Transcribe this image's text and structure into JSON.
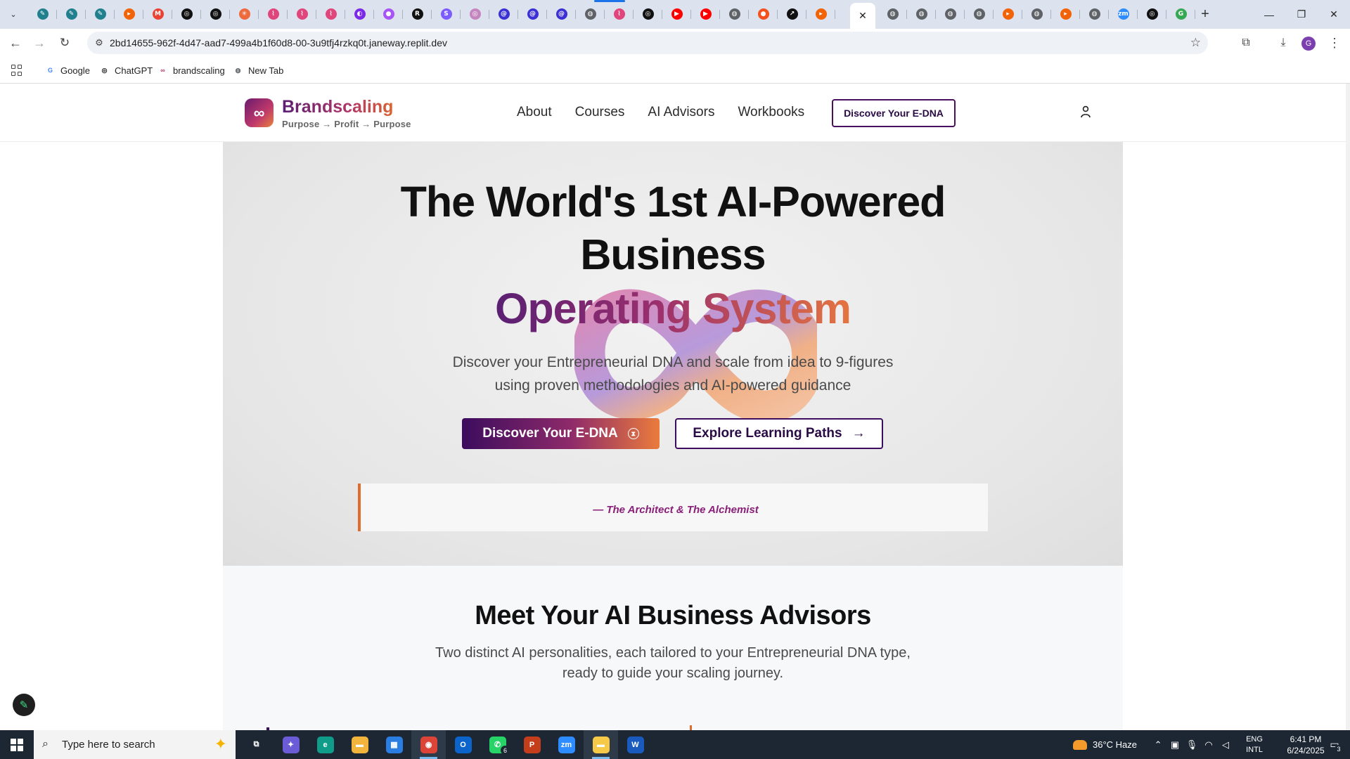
{
  "browser": {
    "url": "2bd14655-962f-4d47-aad7-499a4b1f60d8-00-3u9tfj4rzkq0t.janeway.replit.dev",
    "tab_favicons": [
      {
        "icon": "perplexity-icon",
        "color": "#20808d",
        "glyph": "✎"
      },
      {
        "icon": "perplexity-icon",
        "color": "#20808d",
        "glyph": "✎"
      },
      {
        "icon": "perplexity-icon",
        "color": "#20808d",
        "glyph": "✎"
      },
      {
        "icon": "replit-icon",
        "color": "#f26207",
        "glyph": "▸"
      },
      {
        "icon": "gmail-icon",
        "color": "#ea4335",
        "glyph": "M"
      },
      {
        "icon": "chatgpt-icon",
        "color": "#111111",
        "glyph": "◎"
      },
      {
        "icon": "chatgpt-icon",
        "color": "#111111",
        "glyph": "◎"
      },
      {
        "icon": "claude-icon",
        "color": "#ee6a3c",
        "glyph": "✳"
      },
      {
        "icon": "make-icon",
        "color": "#e0457b",
        "glyph": "⌇"
      },
      {
        "icon": "make-icon",
        "color": "#e0457b",
        "glyph": "⌇"
      },
      {
        "icon": "make-icon",
        "color": "#e0457b",
        "glyph": "⌇"
      },
      {
        "icon": "canva-icon",
        "color": "#7d2ae8",
        "glyph": "◐"
      },
      {
        "icon": "shape-icon",
        "color": "#a855f7",
        "glyph": "●"
      },
      {
        "icon": "r-icon",
        "color": "#111111",
        "glyph": "R"
      },
      {
        "icon": "s-icon",
        "color": "#7c5cff",
        "glyph": "S"
      },
      {
        "icon": "wix-icon",
        "color": "#c586c0",
        "glyph": "◎"
      },
      {
        "icon": "at-icon",
        "color": "#3b2fd6",
        "glyph": "@"
      },
      {
        "icon": "at-icon",
        "color": "#3b2fd6",
        "glyph": "@"
      },
      {
        "icon": "at-icon",
        "color": "#3b2fd6",
        "glyph": "@"
      },
      {
        "icon": "globe-icon",
        "color": "#5f6368",
        "glyph": "◍"
      },
      {
        "icon": "make-icon",
        "color": "#e0457b",
        "glyph": "⌇"
      },
      {
        "icon": "chatgpt-icon",
        "color": "#111111",
        "glyph": "◎"
      },
      {
        "icon": "youtube-icon",
        "color": "#ff0000",
        "glyph": "▶"
      },
      {
        "icon": "youtube-icon",
        "color": "#ff0000",
        "glyph": "▶"
      },
      {
        "icon": "globe-icon",
        "color": "#5f6368",
        "glyph": "◍"
      },
      {
        "icon": "record-icon",
        "color": "#f4511e",
        "glyph": "●"
      },
      {
        "icon": "chart-icon",
        "color": "#111111",
        "glyph": "↗"
      },
      {
        "icon": "replit-icon",
        "color": "#f26207",
        "glyph": "▸"
      }
    ],
    "tab_favicons_right": [
      {
        "icon": "globe-icon",
        "color": "#5f6368",
        "glyph": "◍"
      },
      {
        "icon": "globe-icon",
        "color": "#5f6368",
        "glyph": "◍"
      },
      {
        "icon": "globe-icon",
        "color": "#5f6368",
        "glyph": "◍"
      },
      {
        "icon": "globe-icon",
        "color": "#5f6368",
        "glyph": "◍"
      },
      {
        "icon": "replit-icon",
        "color": "#f26207",
        "glyph": "▸"
      },
      {
        "icon": "globe-icon",
        "color": "#5f6368",
        "glyph": "◍"
      },
      {
        "icon": "replit-icon",
        "color": "#f26207",
        "glyph": "▸"
      },
      {
        "icon": "globe-icon",
        "color": "#5f6368",
        "glyph": "◍"
      },
      {
        "icon": "zoom-icon",
        "color": "#2d8cff",
        "glyph": "zm"
      },
      {
        "icon": "chatgpt-icon",
        "color": "#111111",
        "glyph": "◎"
      },
      {
        "icon": "google-lens-icon",
        "color": "#34a853",
        "glyph": "G"
      }
    ],
    "bookmarks": [
      {
        "label": "Google",
        "icon": "google-icon",
        "color": "#4285f4",
        "glyph": "G"
      },
      {
        "label": "ChatGPT",
        "icon": "chatgpt-icon",
        "color": "#111111",
        "glyph": "◎"
      },
      {
        "label": "brandscaling",
        "icon": "brandscaling-icon",
        "color": "#b0366a",
        "glyph": "∞"
      },
      {
        "label": "New Tab",
        "icon": "globe-icon",
        "color": "#5f6368",
        "glyph": "◍"
      }
    ],
    "profile_initial": "G"
  },
  "site": {
    "brand": "Brandscaling",
    "tagline": "Purpose → Profit → Purpose",
    "nav": [
      "About",
      "Courses",
      "AI Advisors",
      "Workbooks"
    ],
    "nav_cta": "Discover Your E-DNA",
    "colors": {
      "purple": "#3c0c5e",
      "magenta": "#8a1f78",
      "orange": "#e06b2e"
    }
  },
  "hero": {
    "title_line1": "The World's 1st AI-Powered",
    "title_line2": "Business",
    "title_accent": "Operating System",
    "subtitle_line1": "Discover your Entrepreneurial DNA and scale from idea to 9-figures",
    "subtitle_line2": "using proven methodologies and AI-powered guidance",
    "primary_button": "Discover Your E-DNA",
    "secondary_button": "Explore Learning Paths",
    "quote_attribution": "— The Architect & The Alchemist"
  },
  "advisors": {
    "title": "Meet Your AI Business Advisors",
    "subtitle_line1": "Two distinct AI personalities, each tailored to your Entrepreneurial DNA type,",
    "subtitle_line2": "ready to guide your scaling journey."
  },
  "taskbar": {
    "search_placeholder": "Type here to search",
    "apps": [
      {
        "name": "task-view",
        "color": "#1c2733",
        "glyph": "⧉"
      },
      {
        "name": "copilot",
        "color": "#6b5bd6",
        "glyph": "✦"
      },
      {
        "name": "edge",
        "color": "#0f9d8a",
        "glyph": "e"
      },
      {
        "name": "file-explorer",
        "color": "#f2b43c",
        "glyph": "▬"
      },
      {
        "name": "microsoft-store",
        "color": "#2a7de1",
        "glyph": "▦"
      },
      {
        "name": "chrome",
        "color": "#db4437",
        "glyph": "◉",
        "active": true
      },
      {
        "name": "outlook",
        "color": "#0a64c9",
        "glyph": "O"
      },
      {
        "name": "whatsapp",
        "color": "#25d366",
        "glyph": "✆",
        "badge": "6"
      },
      {
        "name": "powerpoint",
        "color": "#c43e1c",
        "glyph": "P"
      },
      {
        "name": "zoom",
        "color": "#2d8cff",
        "glyph": "zm"
      },
      {
        "name": "sticky-notes",
        "color": "#f7c948",
        "glyph": "▬",
        "active": true
      },
      {
        "name": "word",
        "color": "#185abd",
        "glyph": "W"
      }
    ],
    "weather": "36°C  Haze",
    "weather_alert": "1",
    "lang_line1": "ENG",
    "lang_line2": "INTL",
    "time": "6:41 PM",
    "date": "6/24/2025",
    "notifications": "3"
  }
}
